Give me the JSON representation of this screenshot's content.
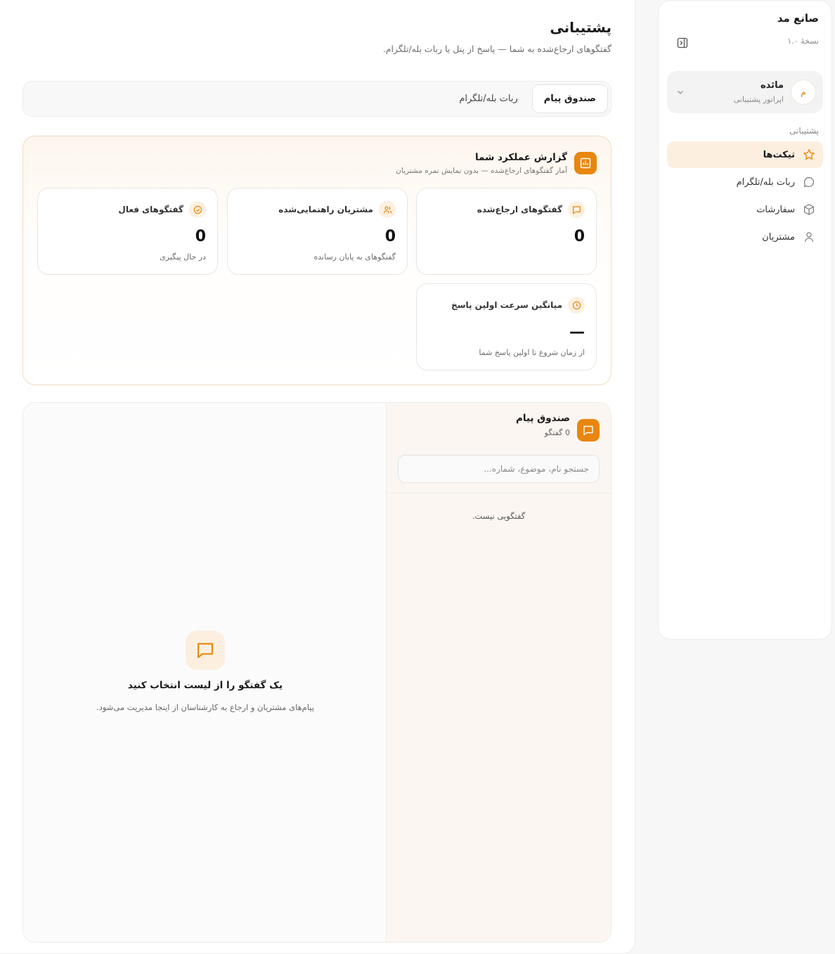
{
  "sidebar": {
    "brand_title": "صانع مد",
    "version": "نسخهٔ ۱.۰",
    "user": {
      "initial": "م",
      "name": "مائده",
      "role": "اپراتور پشتیبانی"
    },
    "section_label": "پشتیبانی",
    "items": [
      {
        "label": "تیکت‌ها",
        "icon": "star-icon",
        "active": true
      },
      {
        "label": "ربات بله/تلگرام",
        "icon": "chat-bubble-icon",
        "active": false
      },
      {
        "label": "سفارشات",
        "icon": "box-icon",
        "active": false
      },
      {
        "label": "مشتریان",
        "icon": "user-icon",
        "active": false
      }
    ]
  },
  "page": {
    "title": "پشتیبانی",
    "subtitle": "گفتگوهای ارجاع‌شده به شما — پاسخ از پنل یا ربات بله/تلگرام."
  },
  "tabs": [
    {
      "label": "صندوق پیام",
      "active": true
    },
    {
      "label": "ربات بله/تلگرام",
      "active": false
    }
  ],
  "report": {
    "title": "گزارش عملکرد شما",
    "subtitle": "آمار گفتگوهای ارجاع‌شده — بدون نمایش نمره مشتریان",
    "stats": [
      {
        "label": "گفتگوهای ارجاع‌شده",
        "value": "0",
        "note": "",
        "icon": "message-square-icon"
      },
      {
        "label": "مشتریان راهنمایی‌شده",
        "value": "0",
        "note": "گفتگوهای به پایان رسانده",
        "icon": "users-icon"
      },
      {
        "label": "گفتگوهای فعال",
        "value": "0",
        "note": "در حال پیگیری",
        "icon": "check-circle-icon"
      },
      {
        "label": "میانگین سرعت اولین پاسخ",
        "value": "—",
        "note": "از زمان شروع تا اولین پاسخ شما",
        "icon": "clock-icon"
      }
    ]
  },
  "inbox": {
    "title": "صندوق پیام",
    "count": "0 گفتگو",
    "search_placeholder": "جستجو نام، موضوع، شماره...",
    "empty_list": "گفتگویی نیست.",
    "empty_title": "یک گفتگو را از لیست انتخاب کنید",
    "empty_subtitle": "پیام‌های مشتریان و ارجاع به کارشناسان از اینجا مدیریت می‌شود."
  },
  "colors": {
    "accent": "#e8860e",
    "accent_soft": "#fcefe0"
  }
}
